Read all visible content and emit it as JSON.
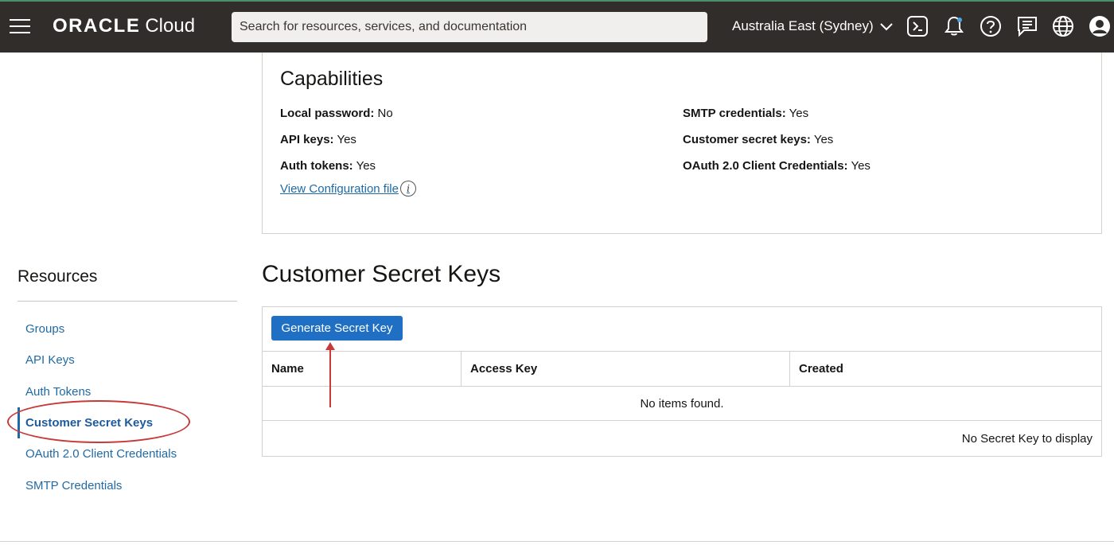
{
  "header": {
    "brand_oracle": "ORACLE",
    "brand_cloud": "Cloud",
    "search_placeholder": "Search for resources, services, and documentation",
    "region": "Australia East (Sydney)",
    "icons": [
      "menu-icon",
      "cloud-shell-icon",
      "bell-icon",
      "help-icon",
      "chat-icon",
      "globe-icon",
      "profile-icon"
    ]
  },
  "capabilities": {
    "title": "Capabilities",
    "left": [
      {
        "label": "Local password:",
        "value": "No"
      },
      {
        "label": "API keys:",
        "value": "Yes"
      },
      {
        "label": "Auth tokens:",
        "value": "Yes"
      }
    ],
    "right": [
      {
        "label": "SMTP credentials:",
        "value": "Yes"
      },
      {
        "label": "Customer secret keys:",
        "value": "Yes"
      },
      {
        "label": "OAuth 2.0 Client Credentials:",
        "value": "Yes"
      }
    ],
    "config_link": "View Configuration file"
  },
  "resources": {
    "title": "Resources",
    "items": [
      {
        "label": "Groups"
      },
      {
        "label": "API Keys"
      },
      {
        "label": "Auth Tokens"
      },
      {
        "label": "Customer Secret Keys",
        "active": true
      },
      {
        "label": "OAuth 2.0 Client Credentials"
      },
      {
        "label": "SMTP Credentials"
      }
    ]
  },
  "secret_keys": {
    "title": "Customer Secret Keys",
    "generate_button": "Generate Secret Key",
    "columns": [
      "Name",
      "Access Key",
      "Created"
    ],
    "empty_message": "No items found.",
    "footer": "No Secret Key to display"
  },
  "colors": {
    "header_bg": "#312d2a",
    "link": "#1f6aa5",
    "primary_button": "#1f6fc5",
    "annotation": "#c83a3a"
  }
}
